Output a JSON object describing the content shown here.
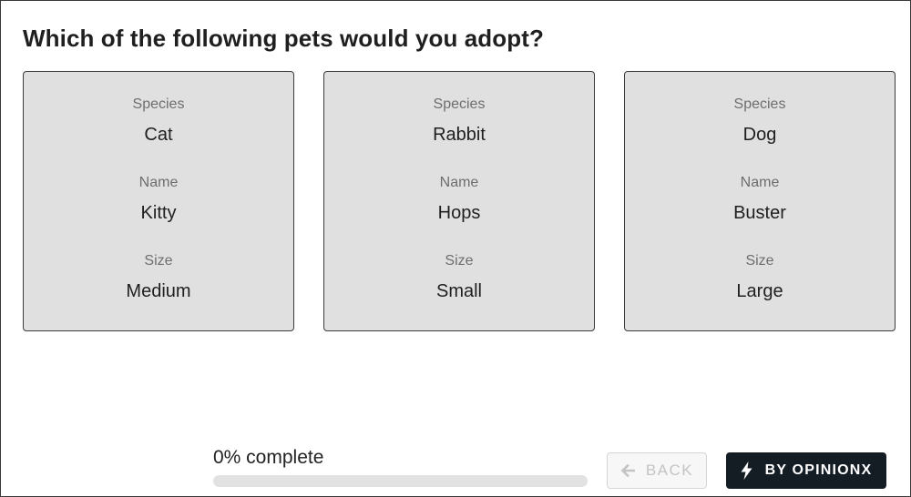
{
  "question": "Which of the following pets would you adopt?",
  "cards": [
    {
      "attributes": [
        {
          "label": "Species",
          "value": "Cat"
        },
        {
          "label": "Name",
          "value": "Kitty"
        },
        {
          "label": "Size",
          "value": "Medium"
        }
      ]
    },
    {
      "attributes": [
        {
          "label": "Species",
          "value": "Rabbit"
        },
        {
          "label": "Name",
          "value": "Hops"
        },
        {
          "label": "Size",
          "value": "Small"
        }
      ]
    },
    {
      "attributes": [
        {
          "label": "Species",
          "value": "Dog"
        },
        {
          "label": "Name",
          "value": "Buster"
        },
        {
          "label": "Size",
          "value": "Large"
        }
      ]
    }
  ],
  "progress": {
    "text": "0% complete",
    "fraction": 0
  },
  "footer": {
    "back_label": "BACK",
    "back_icon": "arrow-left-icon",
    "brand_label": "BY OPINIONX",
    "brand_icon": "lightning-bolt-icon"
  },
  "colors": {
    "card_background": "#e0e0e0",
    "brand_button": "#141c24",
    "disabled_text": "#c4c4c4"
  }
}
